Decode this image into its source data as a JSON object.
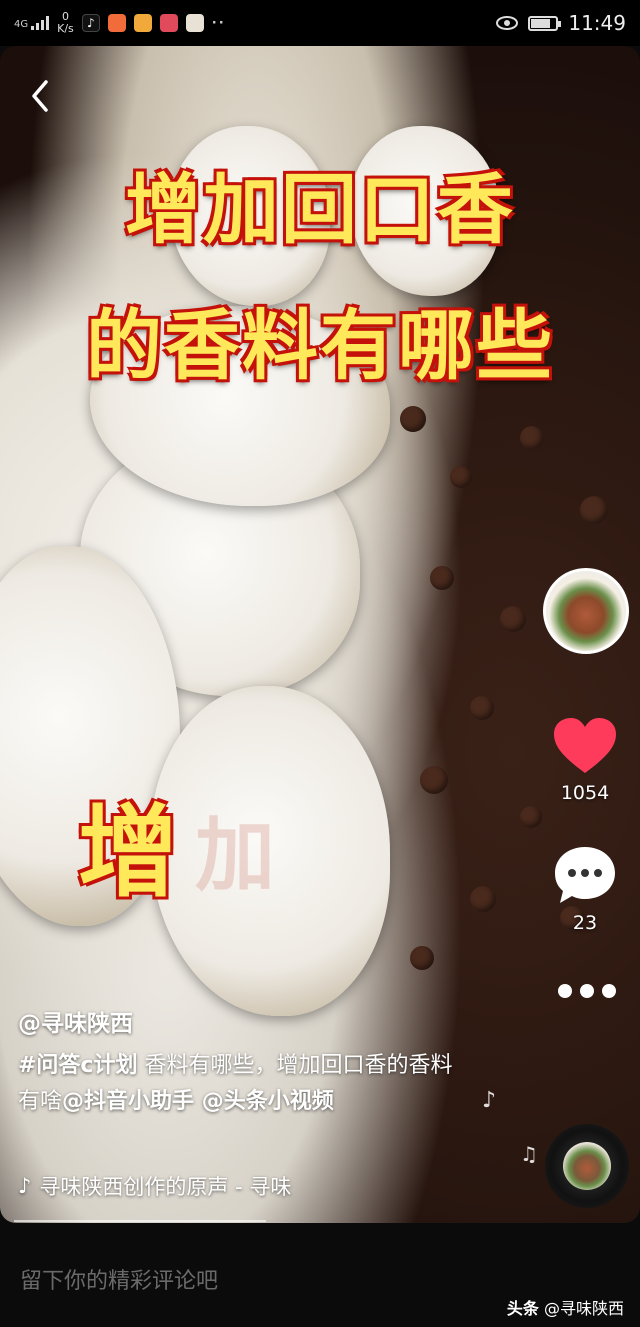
{
  "status_bar": {
    "network": "4G",
    "speed_value": "0",
    "speed_unit": "K/s",
    "time": "11:49"
  },
  "video": {
    "title_line1": "增加回口香",
    "title_line2": "的香料有哪些",
    "overlay_word": "增",
    "overlay_faded": "加"
  },
  "actions": {
    "likes": "1054",
    "comments": "23"
  },
  "post": {
    "author": "@寻味陕西",
    "hashtag": "#问答c计划",
    "text1": " 香料有哪些，增加回口香的香料有啥",
    "mention1": "@抖音小助手",
    "mention2": " @头条小视频",
    "music": "寻味陕西创作的原声 - 寻味"
  },
  "comment_bar": {
    "placeholder": "留下你的精彩评论吧",
    "watermark_brand": "头条",
    "watermark_handle": " @寻味陕西"
  },
  "colors": {
    "title_fill": "#ffe95a",
    "title_outline": "#c4120a",
    "like": "#ff3b5c"
  }
}
